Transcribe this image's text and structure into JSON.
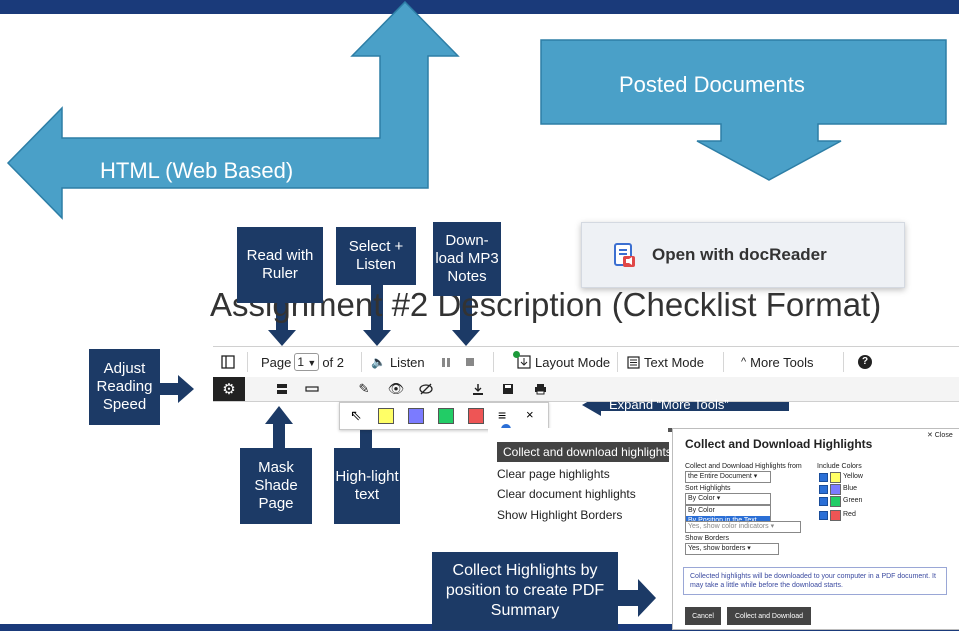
{
  "big_arrows": {
    "html_label": "HTML (Web Based)",
    "posted_label": "Posted Documents",
    "color": "#4aa0c8"
  },
  "docreader": {
    "label": "Open with docReader",
    "icon": "doc-audio-icon"
  },
  "heading": "Assignment #2 Description (Checklist Format)",
  "callouts": {
    "read_ruler": "Read with Ruler",
    "select_listen": "Select + Listen",
    "download_mp3": "Down-load MP3 Notes",
    "adjust_speed": "Adjust Reading Speed",
    "mask_shade": "Mask Shade Page",
    "highlight_text": "High-light text",
    "expand_more": "Expand “More Tools”",
    "collect_pdf": "Collect Highlights by position to create PDF Summary"
  },
  "toolbar": {
    "page_prefix": "Page",
    "page_value": "1",
    "page_suffix": "of 2",
    "listen": "Listen",
    "layout_mode": "Layout Mode",
    "text_mode": "Text Mode",
    "more_tools": "More Tools",
    "help": "?"
  },
  "highlight_bar": {
    "colors": [
      "#ffff66",
      "#7b7bff",
      "#22cc66",
      "#ee5555"
    ],
    "close": "×"
  },
  "menu": {
    "items": [
      "Collect and download highlights",
      "Clear page highlights",
      "Clear document highlights",
      "Show Highlight Borders"
    ]
  },
  "dialog": {
    "close": "✕ Close",
    "title": "Collect and Download Highlights",
    "from_label": "Collect and Download Highlights from",
    "from_value": "the Entire Document",
    "include_label": "Include Colors",
    "colors": [
      {
        "name": "Yellow",
        "hex": "#ffff66"
      },
      {
        "name": "Blue",
        "hex": "#7b7bff"
      },
      {
        "name": "Green",
        "hex": "#22cc66"
      },
      {
        "name": "Red",
        "hex": "#ee5555"
      }
    ],
    "sort_label": "Sort Highlights",
    "sort_value": "By Color",
    "sort_options": [
      "By Color",
      "By Position in the Text"
    ],
    "hidden_select": "Yes, show color indicators",
    "borders_label": "Show Borders",
    "borders_value": "Yes, show borders",
    "note": "Collected highlights will be downloaded to your computer in a PDF document. It may take a little while before the download starts.",
    "cancel": "Cancel",
    "collect": "Collect and Download"
  },
  "colors": {
    "callout_bg": "#1c3a66",
    "banner": "#1a3a7a",
    "accent_blue": "#2b6fd6"
  }
}
